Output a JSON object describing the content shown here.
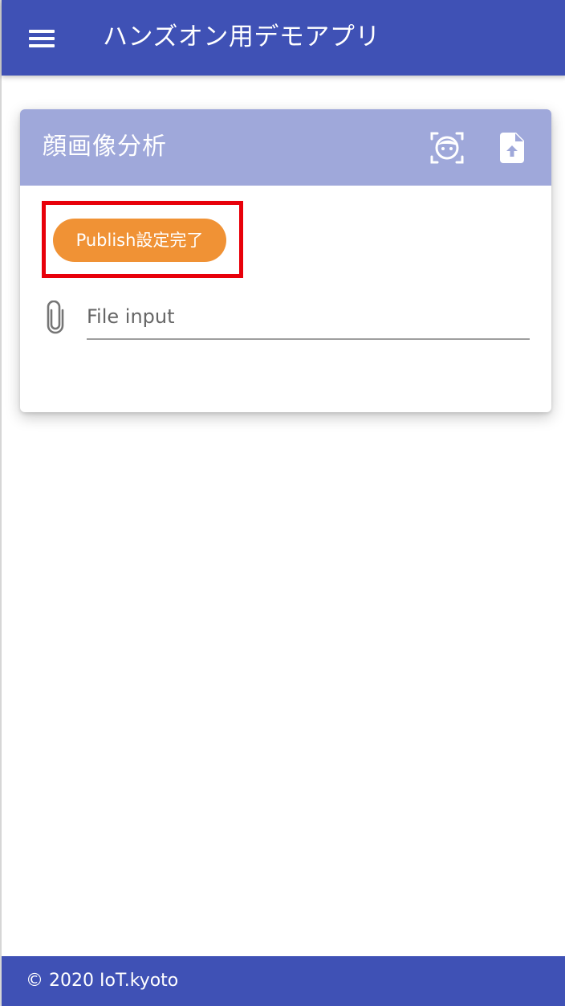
{
  "app_bar": {
    "title": "ハンズオン用デモアプリ",
    "menu_icon": "hamburger-menu-icon",
    "background_color": "#3f51b5"
  },
  "card": {
    "title": "顔画像分析",
    "header_color": "#9fa8da",
    "icons": [
      "face-recognition-icon",
      "file-upload-icon"
    ],
    "publish_button_label": "Publish設定完了",
    "publish_button_color": "#f09235",
    "highlight_color": "#e8000a",
    "file_input": {
      "label": "File input",
      "icon": "paperclip-icon"
    }
  },
  "footer": {
    "text": "© 2020 IoT.kyoto",
    "background_color": "#3f51b5"
  }
}
